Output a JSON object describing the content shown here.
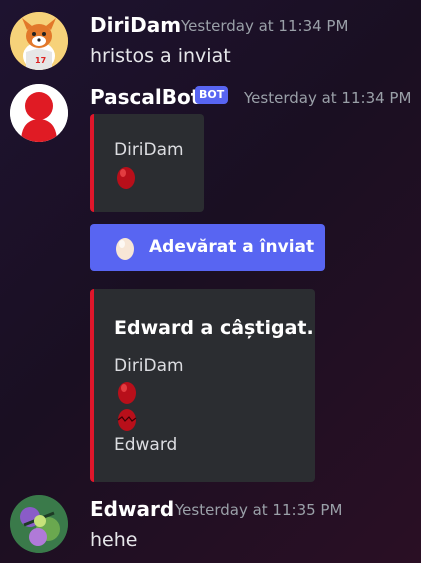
{
  "messages": [
    {
      "username": "DiriDam",
      "timestamp": "Yesterday at 11:34 PM",
      "text": "hristos a inviat",
      "avatar": "fox-avatar"
    },
    {
      "username": "PascalBot",
      "bot_tag": "BOT",
      "timestamp": "Yesterday at 11:34 PM",
      "avatar": "red-figure-avatar",
      "embed1": {
        "line": "DiriDam",
        "egg": "red-egg-icon"
      },
      "button": {
        "label": "Adevărat a înviat",
        "icon": "white-egg-icon"
      },
      "embed2": {
        "title": "Edward a câștigat.",
        "line1": "DiriDam",
        "line2": "Edward",
        "eggs": [
          "red-egg-icon",
          "cracked-red-egg-icon"
        ]
      }
    },
    {
      "username": "Edward",
      "timestamp": "Yesterday at 11:35 PM",
      "text": "hehe",
      "avatar": "green-purple-avatar"
    }
  ],
  "colors": {
    "accent": "#5865f2",
    "embed_bar": "#e0162b",
    "embed_bg": "#2b2d31"
  }
}
